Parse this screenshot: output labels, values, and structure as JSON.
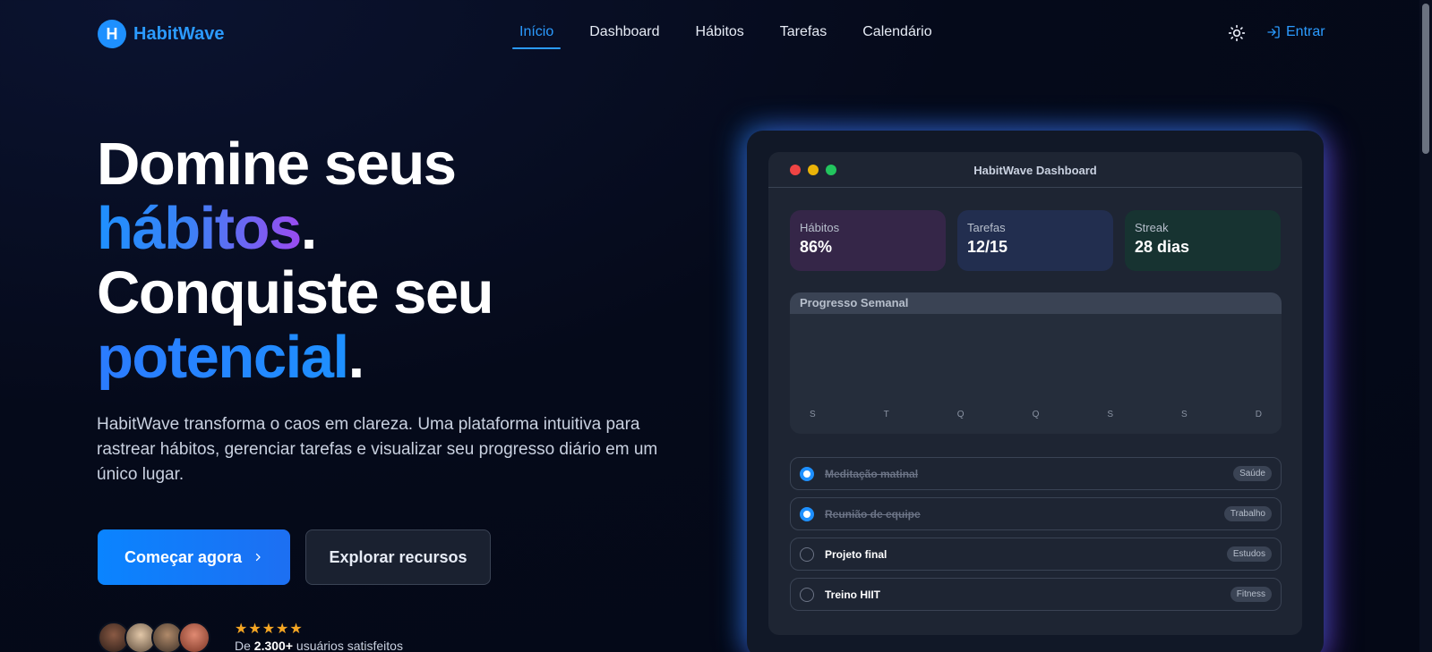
{
  "brand": {
    "initial": "H",
    "name": "HabitWave"
  },
  "nav": {
    "items": [
      {
        "label": "Início",
        "active": true
      },
      {
        "label": "Dashboard",
        "active": false
      },
      {
        "label": "Hábitos",
        "active": false
      },
      {
        "label": "Tarefas",
        "active": false
      },
      {
        "label": "Calendário",
        "active": false
      }
    ],
    "theme_icon": "sun-icon",
    "login_label": "Entrar"
  },
  "hero": {
    "line1": "Domine seus",
    "line2_highlight": "hábitos",
    "line2_suffix": ".",
    "line3": "Conquiste seu",
    "line4_highlight": "potencial",
    "line4_suffix": ".",
    "description": "HabitWave transforma o caos em clareza. Uma plataforma intuitiva para rastrear hábitos, gerenciar tarefas e visualizar seu progresso diário em um único lugar.",
    "primary_button": "Começar agora",
    "secondary_button": "Explorar recursos",
    "rating_stars": "★★★★★",
    "users_prefix": "De",
    "users_count": "2.300+",
    "users_suffix": "usuários satisfeitos"
  },
  "dashboard": {
    "title": "HabitWave Dashboard",
    "stats": [
      {
        "label": "Hábitos",
        "value": "86%"
      },
      {
        "label": "Tarefas",
        "value": "12/15"
      },
      {
        "label": "Streak",
        "value": "28 dias"
      }
    ],
    "progress_title": "Progresso Semanal",
    "days": [
      "S",
      "T",
      "Q",
      "Q",
      "S",
      "S",
      "D"
    ],
    "tasks": [
      {
        "name": "Meditação matinal",
        "tag": "Saúde",
        "done": true
      },
      {
        "name": "Reunião de equipe",
        "tag": "Trabalho",
        "done": true
      },
      {
        "name": "Projeto final",
        "tag": "Estudos",
        "done": false
      },
      {
        "name": "Treino HIIT",
        "tag": "Fitness",
        "done": false
      }
    ]
  },
  "colors": {
    "accent": "#1e90ff",
    "gradient_purple": "#9b4bf0",
    "stars": "#f5a623",
    "dot_red": "#ef4444",
    "dot_yellow": "#eab308",
    "dot_green": "#22c55e"
  }
}
